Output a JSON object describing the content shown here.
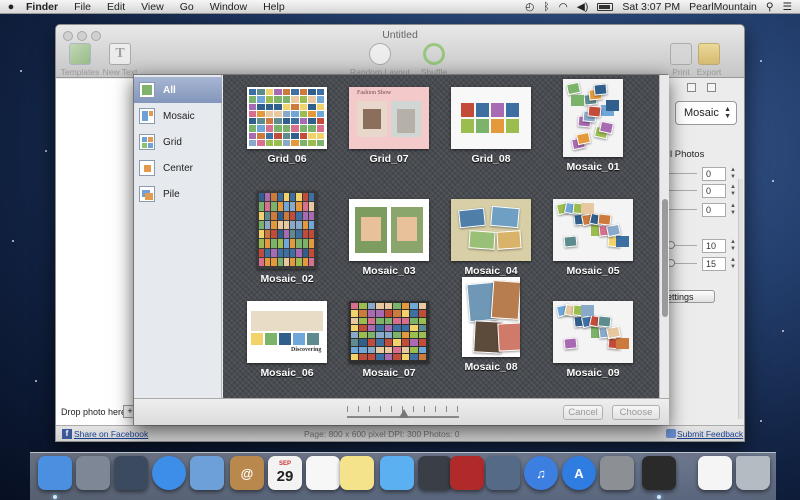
{
  "menubar": {
    "apple_icon": "apple-logo",
    "app_name": "Finder",
    "menus": [
      "File",
      "Edit",
      "View",
      "Go",
      "Window",
      "Help"
    ],
    "clock": "Sat 3:07 PM",
    "user": "PearlMountain",
    "status_icons": [
      "time-machine-icon",
      "bluetooth-icon",
      "wifi-icon",
      "volume-icon",
      "battery-icon",
      "search-icon"
    ]
  },
  "window": {
    "title": "Untitled",
    "toolbar": {
      "templates_label": "Templates",
      "new_text_label": "New Text",
      "random_layout_label": "Random Layout",
      "shuffle_label": "Shuffle",
      "print_label": "Print",
      "export_label": "Export"
    },
    "drop_photo_label": "Drop photo here",
    "add_label": "+",
    "share_label": "Share on Facebook",
    "page_info": "Page: 800 x 600 pixel DPI: 300 Photos: 0",
    "submit_feedback_label": "Submit Feedback",
    "inspector": {
      "layout_select": "Mosaic",
      "photos_label": "l Photos",
      "fields": [
        "0",
        "0",
        "0"
      ],
      "field_10": "10",
      "field_15": "15",
      "settings_button": "ettings"
    }
  },
  "sheet": {
    "categories": [
      {
        "label": "All",
        "selected": true
      },
      {
        "label": "Mosaic",
        "selected": false
      },
      {
        "label": "Grid",
        "selected": false
      },
      {
        "label": "Center",
        "selected": false
      },
      {
        "label": "Pile",
        "selected": false
      }
    ],
    "templates": [
      {
        "name": "Grid_06",
        "style": "grid-dense",
        "bg": "#ffffff"
      },
      {
        "name": "Grid_07",
        "style": "pink-two",
        "bg": "#f4c9c9"
      },
      {
        "name": "Grid_08",
        "style": "grid-eight",
        "bg": "#f8f8f8"
      },
      {
        "name": "Mosaic_01",
        "style": "mosaic-scatter",
        "bg": "#f4f4f4"
      },
      {
        "name": "Mosaic_02",
        "style": "grid-dense",
        "bg": "#3a3a3a"
      },
      {
        "name": "Mosaic_03",
        "style": "girls-two",
        "bg": "#ffffff"
      },
      {
        "name": "Mosaic_04",
        "style": "beige-scatter",
        "bg": "#d8cfa6"
      },
      {
        "name": "Mosaic_05",
        "style": "mosaic-scatter",
        "bg": "#f4f4f4"
      },
      {
        "name": "Mosaic_06",
        "style": "discovering",
        "bg": "#ffffff"
      },
      {
        "name": "Mosaic_07",
        "style": "grid-dense",
        "bg": "#2f2f2f"
      },
      {
        "name": "Mosaic_08",
        "style": "portrait-stack",
        "bg": "#ffffff"
      },
      {
        "name": "Mosaic_09",
        "style": "mosaic-scatter",
        "bg": "#f4f4f4"
      }
    ],
    "grid07_caption": "Fashion Show",
    "mosaic06_caption": "Discovering",
    "cancel_label": "Cancel",
    "choose_label": "Choose"
  },
  "dock": {
    "apps": [
      {
        "name": "finder-icon",
        "color": "#4a8fe0"
      },
      {
        "name": "launchpad-icon",
        "color": "#7d8796"
      },
      {
        "name": "mission-control-icon",
        "color": "#3b4a5e"
      },
      {
        "name": "safari-icon",
        "color": "#3d8ee8"
      },
      {
        "name": "mail-icon",
        "color": "#6da0d8"
      },
      {
        "name": "contacts-icon",
        "color": "#b8884d"
      },
      {
        "name": "calendar-icon",
        "color": "#f3f3f3"
      },
      {
        "name": "reminders-icon",
        "color": "#f7f7f7"
      },
      {
        "name": "notes-icon",
        "color": "#f4e38a"
      },
      {
        "name": "messages-icon",
        "color": "#5ab0f0"
      },
      {
        "name": "facetime-icon",
        "color": "#3a3f47"
      },
      {
        "name": "photo-booth-icon",
        "color": "#b02a2a"
      },
      {
        "name": "iphoto-icon",
        "color": "#546a86"
      },
      {
        "name": "itunes-icon",
        "color": "#3d7fe0"
      },
      {
        "name": "app-store-icon",
        "color": "#2f7de1"
      },
      {
        "name": "system-preferences-icon",
        "color": "#8c8f94"
      },
      {
        "name": "collage-app-icon",
        "color": "#2a2a2a"
      },
      {
        "name": "document-icon",
        "color": "#f5f5f5"
      },
      {
        "name": "trash-icon",
        "color": "#b5bbc2"
      }
    ],
    "calendar_month": "SEP",
    "calendar_day": "29"
  }
}
